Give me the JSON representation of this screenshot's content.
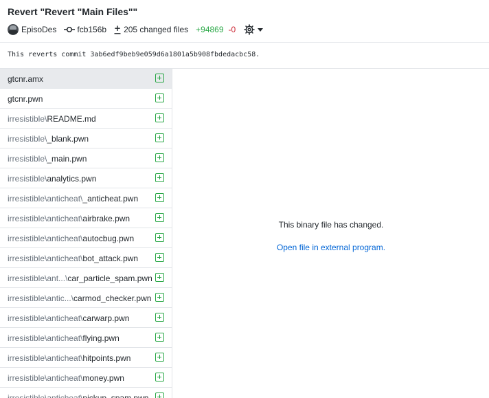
{
  "commit": {
    "title": "Revert \"Revert \"Main Files\"\"",
    "author": "EpisoDes",
    "sha": "fcb156b",
    "changed_files": "205 changed files",
    "additions": "+94869",
    "deletions": "-0",
    "message": "This reverts commit 3ab6edf9beb9e059d6a1801a5b908fbdedacbc58."
  },
  "icons": {
    "avatar": "user-avatar",
    "commit": "git-commit-icon",
    "changed": "diff-changed-icon",
    "settings": "gear-icon",
    "added": "diff-added-icon"
  },
  "colors": {
    "additions": "#28a745",
    "deletions": "#cb2431",
    "link": "#0366d6",
    "selected_bg": "#e8eaed"
  },
  "files": [
    {
      "dir": "",
      "name": "gtcnr.amx",
      "selected": true
    },
    {
      "dir": "",
      "name": "gtcnr.pwn"
    },
    {
      "dir": "irresistible\\",
      "name": "README.md"
    },
    {
      "dir": "irresistible\\",
      "name": "_blank.pwn"
    },
    {
      "dir": "irresistible\\",
      "name": "_main.pwn"
    },
    {
      "dir": "irresistible\\",
      "name": "analytics.pwn"
    },
    {
      "dir": "irresistible\\anticheat\\",
      "name": "_anticheat.pwn"
    },
    {
      "dir": "irresistible\\anticheat\\",
      "name": "airbrake.pwn"
    },
    {
      "dir": "irresistible\\anticheat\\",
      "name": "autocbug.pwn"
    },
    {
      "dir": "irresistible\\anticheat\\",
      "name": "bot_attack.pwn"
    },
    {
      "dir": "irresistible\\ant...\\",
      "name": "car_particle_spam.pwn"
    },
    {
      "dir": "irresistible\\antic...\\",
      "name": "carmod_checker.pwn"
    },
    {
      "dir": "irresistible\\anticheat\\",
      "name": "carwarp.pwn"
    },
    {
      "dir": "irresistible\\anticheat\\",
      "name": "flying.pwn"
    },
    {
      "dir": "irresistible\\anticheat\\",
      "name": "hitpoints.pwn"
    },
    {
      "dir": "irresistible\\anticheat\\",
      "name": "money.pwn"
    },
    {
      "dir": "irresistible\\anticheat\\",
      "name": "pickup_spam.pwn"
    }
  ],
  "diff": {
    "binary_message": "This binary file has changed.",
    "open_link": "Open file in external program."
  }
}
